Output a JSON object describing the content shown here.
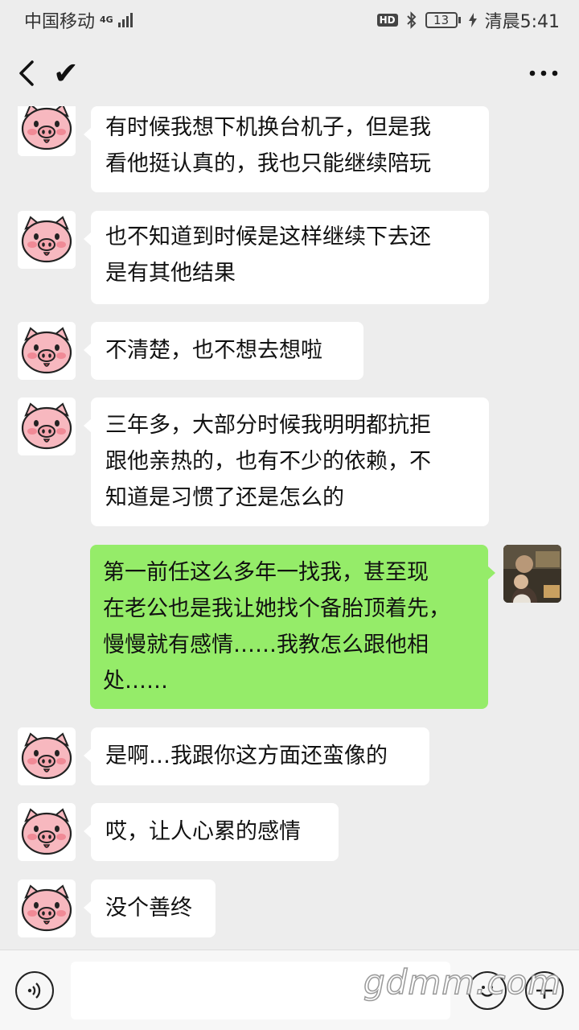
{
  "status_bar": {
    "carrier": "中国移动",
    "network": "4G",
    "hd": "HD",
    "battery": "13",
    "time": "清晨5:41"
  },
  "top_bar": {
    "title": "✔"
  },
  "messages": [
    {
      "side": "left",
      "text": "有时候我想下机换台机子，但是我看他挺认真的，我也只能继续陪玩"
    },
    {
      "side": "left",
      "text": "也不知道到时候是这样继续下去还是有其他结果"
    },
    {
      "side": "left",
      "text": "不清楚，也不想去想啦"
    },
    {
      "side": "left",
      "text": "三年多，大部分时候我明明都抗拒跟他亲热的，也有不少的依赖，不知道是习惯了还是怎么的"
    },
    {
      "side": "right",
      "text": "第一前任这么多年一找我，甚至现在老公也是我让她找个备胎顶着先，慢慢就有感情……我教怎么跟他相处……"
    },
    {
      "side": "left",
      "text": "是啊…我跟你这方面还蛮像的"
    },
    {
      "side": "left",
      "text": "哎，让人心累的感情"
    },
    {
      "side": "left",
      "text": "没个善终"
    }
  ],
  "display_lines": {
    "m0": "有时候我想下机换台机子，但是我\n看他挺认真的，我也只能继续陪玩",
    "m1": "也不知道到时候是这样继续下去还\n是有其他结果",
    "m2": "不清楚，也不想去想啦",
    "m3": "三年多，大部分时候我明明都抗拒\n跟他亲热的，也有不少的依赖，不\n知道是习惯了还是怎么的",
    "m4": "第一前任这么多年一找我，甚至现\n在老公也是我让她找个备胎顶着先，\n慢慢就有感情……我教怎么跟他相\n处……",
    "m5": "是啊…我跟你这方面还蛮像的",
    "m6": "哎，让人心累的感情",
    "m7": "没个善终"
  },
  "input_bar": {
    "watermark": "gdmm.com"
  },
  "icons": {
    "back": "back-arrow-icon",
    "more": "more-dots-icon",
    "voice": "voice-icon",
    "emoji": "emoji-icon",
    "plus": "plus-icon",
    "avatar_left": "pig-avatar",
    "avatar_right": "photo-avatar"
  },
  "colors": {
    "background": "#ededed",
    "bubble_left": "#ffffff",
    "bubble_right": "#95ec69",
    "pig_pink": "#f7b8bf"
  }
}
